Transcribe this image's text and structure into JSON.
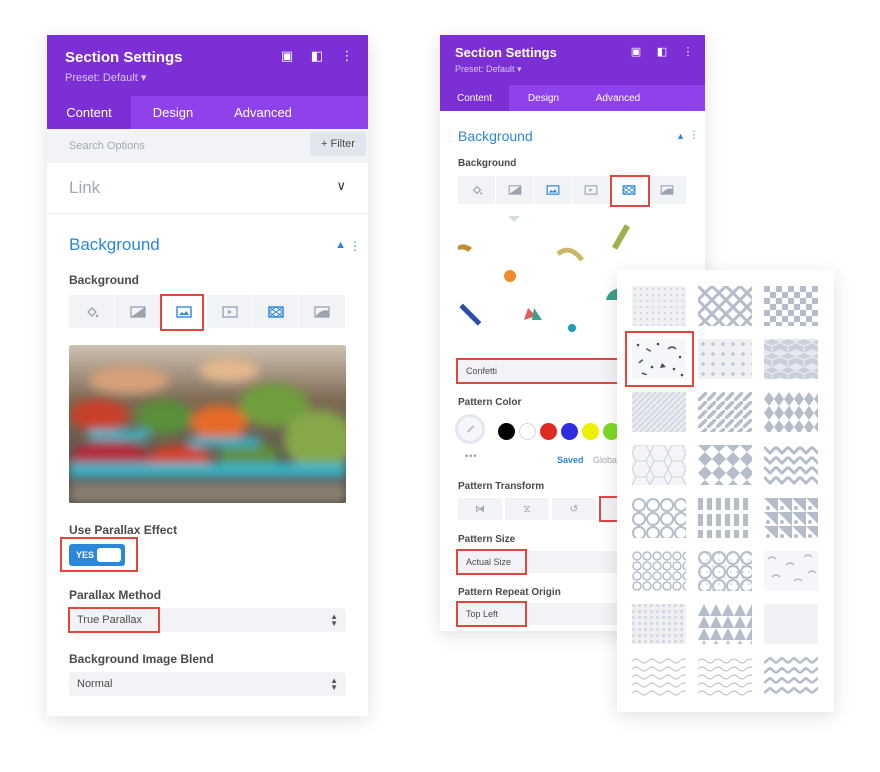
{
  "left_panel": {
    "title": "Section Settings",
    "preset": "Preset: Default ▾",
    "tabs": [
      "Content",
      "Design",
      "Advanced"
    ],
    "search_placeholder": "Search Options",
    "filter_label": "+ Filter",
    "link_section": "Link",
    "background_section": "Background",
    "background_label": "Background",
    "use_parallax_label": "Use Parallax Effect",
    "toggle_yes": "YES",
    "parallax_method_label": "Parallax Method",
    "parallax_method_value": "True Parallax",
    "blend_label": "Background Image Blend",
    "blend_value": "Normal"
  },
  "right_panel": {
    "title": "Section Settings",
    "preset": "Preset: Default ▾",
    "tabs": [
      "Content",
      "Design",
      "Advanced"
    ],
    "background_section": "Background",
    "background_label": "Background",
    "pattern_value": "Confetti",
    "pattern_color_label": "Pattern Color",
    "swatch_colors": [
      "#000000",
      "#ffffff",
      "#e02b20",
      "#2e2ee0",
      "#edf000",
      "#7cda24"
    ],
    "saved_label": "Saved",
    "global_label": "Globa",
    "pattern_transform_label": "Pattern Transform",
    "pattern_size_label": "Pattern Size",
    "pattern_size_value": "Actual Size",
    "pattern_repeat_label": "Pattern Repeat Origin",
    "pattern_repeat_value": "Top Left"
  },
  "colors": {
    "header_purple": "#7b2fd5",
    "tab_purple": "#8f42ec",
    "accent_blue": "#2b87da",
    "highlight_red": "#e1473d",
    "pattern_gray": "#c8cfdc"
  }
}
